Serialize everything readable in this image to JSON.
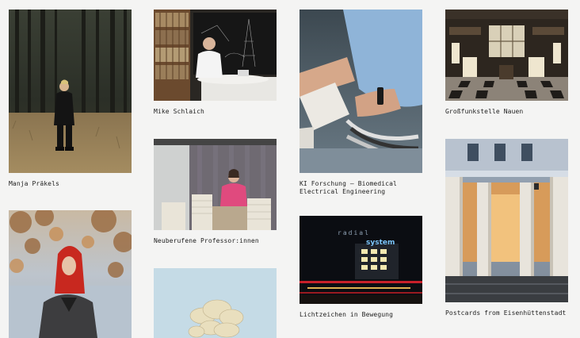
{
  "gallery": {
    "items": [
      {
        "caption": "Manja Präkels"
      },
      {
        "caption": "Mike Schlaich"
      },
      {
        "caption": "Neuberufene Professor:innen"
      },
      {
        "caption": "KI Forschung – Biomedical Electrical Engineering"
      },
      {
        "caption": "Lichtzeichen in Bewegung"
      },
      {
        "caption": "Großfunkstelle Nauen"
      },
      {
        "caption": "Postcards from Eisenhüttenstadt"
      }
    ],
    "image_texts": {
      "lichtzeichen_sign_1": "radial",
      "lichtzeichen_sign_2": "system"
    }
  }
}
